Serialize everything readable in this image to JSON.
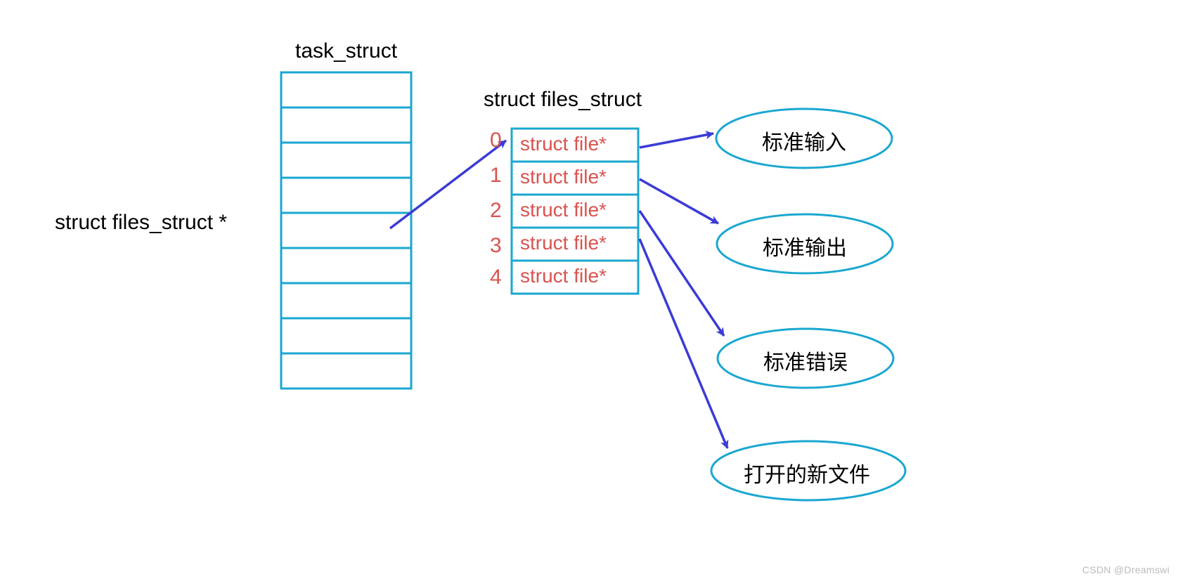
{
  "colors": {
    "box_stroke": "#1aa7d0",
    "arrow_stroke": "#3b3bd6",
    "index_text": "#d9534f",
    "struct_file_text": "#d9534f",
    "label_text": "#000000"
  },
  "task_struct": {
    "title": "task_struct",
    "pointer_label": "struct files_struct  *",
    "cell_count": 9
  },
  "files_struct": {
    "title": "struct files_struct",
    "entries": [
      {
        "index": "0",
        "text": "struct file*"
      },
      {
        "index": "1",
        "text": "struct file*"
      },
      {
        "index": "2",
        "text": "struct file*"
      },
      {
        "index": "3",
        "text": "struct file*"
      },
      {
        "index": "4",
        "text": "struct file*"
      }
    ]
  },
  "targets": [
    "标准输入",
    "标准输出",
    "标准错误",
    "打开的新文件"
  ],
  "watermark": "CSDN @Dreamswi"
}
